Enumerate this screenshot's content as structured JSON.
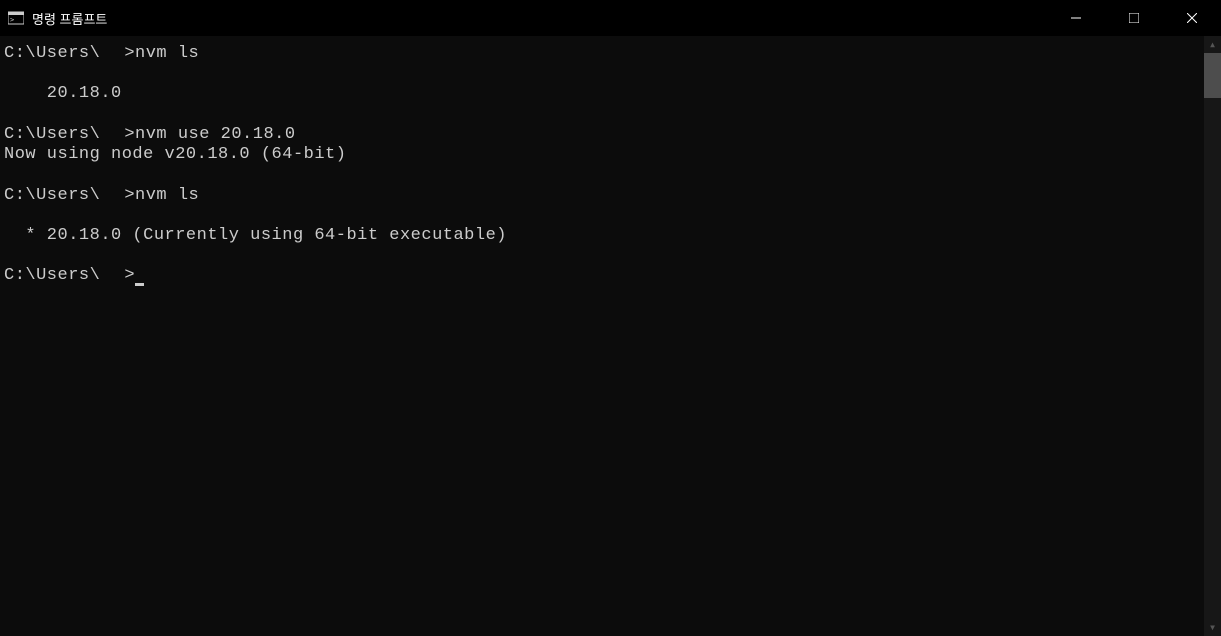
{
  "window": {
    "title": "명령 프롬프트"
  },
  "terminal": {
    "lines": [
      {
        "prompt": "C:\\Users\\",
        "redact": true,
        "after": ">",
        "cmd": "nvm ls"
      },
      {
        "text": ""
      },
      {
        "text": "    20.18.0"
      },
      {
        "text": ""
      },
      {
        "prompt": "C:\\Users\\",
        "redact": true,
        "after": ">",
        "cmd": "nvm use 20.18.0"
      },
      {
        "text": "Now using node v20.18.0 (64-bit)"
      },
      {
        "text": ""
      },
      {
        "prompt": "C:\\Users\\",
        "redact": true,
        "after": ">",
        "cmd": "nvm ls"
      },
      {
        "text": ""
      },
      {
        "text": "  * 20.18.0 (Currently using 64-bit executable)"
      },
      {
        "text": ""
      },
      {
        "prompt": "C:\\Users\\",
        "redact": true,
        "after": ">",
        "cmd": "",
        "cursor": true
      }
    ]
  }
}
